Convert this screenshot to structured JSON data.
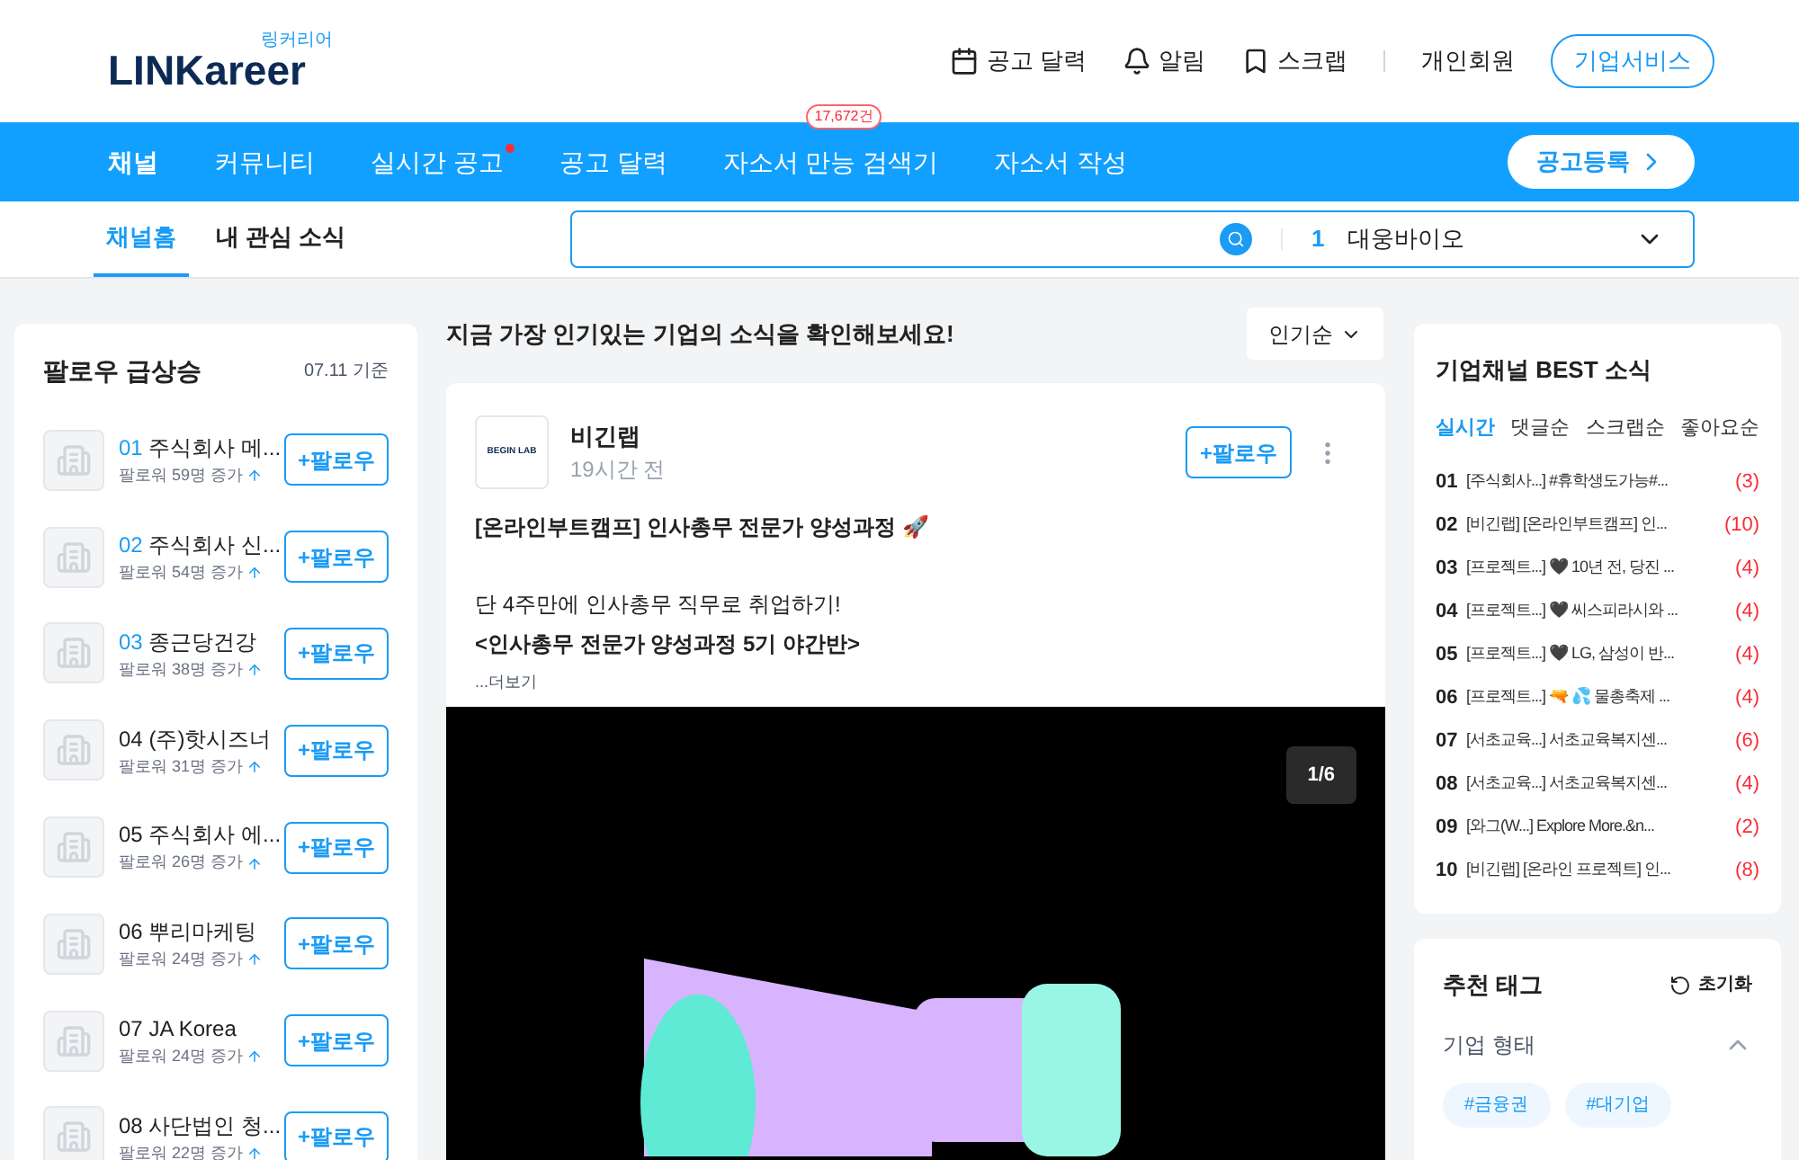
{
  "header": {
    "logo_caption": "링커리어",
    "logo": "LINKareer",
    "links": [
      {
        "kind": "calendar",
        "label": "공고 달력"
      },
      {
        "kind": "bell",
        "label": "알림"
      },
      {
        "kind": "bookmark",
        "label": "스크랩"
      }
    ],
    "member": "개인회원",
    "service_button": "기업서비스"
  },
  "nav": {
    "items": [
      {
        "label": "채널",
        "selected": true,
        "dot": false
      },
      {
        "label": "커뮤니티",
        "selected": false,
        "dot": false
      },
      {
        "label": "실시간 공고",
        "selected": false,
        "dot": true
      },
      {
        "label": "공고 달력",
        "selected": false,
        "dot": false
      },
      {
        "label": "자소서 만능 검색기",
        "selected": false,
        "dot": false,
        "badge": "17,672건"
      },
      {
        "label": "자소서 작성",
        "selected": false,
        "dot": false
      }
    ],
    "cta": "공고등록"
  },
  "subnav": {
    "tabs": [
      {
        "label": "채널홈",
        "selected": true
      },
      {
        "label": "내 관심 소식",
        "selected": false
      }
    ],
    "search": {
      "rank": "1",
      "keyword": "대웅바이오"
    }
  },
  "follow_rank": {
    "title": "팔로우 급상승",
    "date": "07.11 기준",
    "items": [
      {
        "rank": "01",
        "name": "주식회사 메...",
        "increase": "팔로워 59명 증가",
        "top": true,
        "button": "+팔로우"
      },
      {
        "rank": "02",
        "name": "주식회사 신...",
        "increase": "팔로워 54명 증가",
        "top": true,
        "button": "+팔로우"
      },
      {
        "rank": "03",
        "name": "종근당건강",
        "increase": "팔로워 38명 증가",
        "top": true,
        "button": "+팔로우"
      },
      {
        "rank": "04",
        "name": "(주)핫시즈너",
        "increase": "팔로워 31명 증가",
        "top": false,
        "button": "+팔로우"
      },
      {
        "rank": "05",
        "name": "주식회사 에...",
        "increase": "팔로워 26명 증가",
        "top": false,
        "button": "+팔로우"
      },
      {
        "rank": "06",
        "name": "뿌리마케팅",
        "increase": "팔로워 24명 증가",
        "top": false,
        "button": "+팔로우"
      },
      {
        "rank": "07",
        "name": "JA Korea",
        "increase": "팔로워 24명 증가",
        "top": false,
        "button": "+팔로우"
      },
      {
        "rank": "08",
        "name": "사단법인 청...",
        "increase": "팔로워 22명 증가",
        "top": false,
        "button": "+팔로우"
      }
    ]
  },
  "feed": {
    "heading": "지금 가장 인기있는 기업의 소식을 확인해보세요!",
    "sort": "인기순",
    "post": {
      "logo_text": "BEGIN LAB",
      "company": "비긴랩",
      "time": "19시간 전",
      "follow": "+팔로우",
      "title": "[온라인부트캠프] 인사총무 전문가 양성과정 🚀",
      "line1": "단 4주만에 인사총무 직무로 취업하기!",
      "line2": "<인사총무 전문가 양성과정 5기 야간반>",
      "more": "...더보기",
      "counter": "1/6"
    }
  },
  "best": {
    "title": "기업채널 BEST 소식",
    "tabs": [
      {
        "label": "실시간",
        "selected": true
      },
      {
        "label": "댓글순",
        "selected": false
      },
      {
        "label": "스크랩순",
        "selected": false
      },
      {
        "label": "좋아요순",
        "selected": false
      }
    ],
    "items": [
      {
        "rank": "01",
        "text": "[주식회사...] #휴학생도가능#...",
        "count": "(3)"
      },
      {
        "rank": "02",
        "text": "[비긴랩] [온라인부트캠프] 인...",
        "count": "(10)"
      },
      {
        "rank": "03",
        "text": "[프로젝트...] 🖤 10년 전, 당진 ...",
        "count": "(4)"
      },
      {
        "rank": "04",
        "text": "[프로젝트...] 🖤 씨스피라시와 ...",
        "count": "(4)"
      },
      {
        "rank": "05",
        "text": "[프로젝트...] 🖤 LG, 삼성이 반...",
        "count": "(4)"
      },
      {
        "rank": "06",
        "text": "[프로젝트...] 🔫 💦 물총축제 ...",
        "count": "(4)"
      },
      {
        "rank": "07",
        "text": "[서초교육...] 서초교육복지센...",
        "count": "(6)"
      },
      {
        "rank": "08",
        "text": "[서초교육...] 서초교육복지센...",
        "count": "(4)"
      },
      {
        "rank": "09",
        "text": "[와그(W...] Explore More.&n...",
        "count": "(2)"
      },
      {
        "rank": "10",
        "text": "[비긴랩] [온라인 프로젝트] 인...",
        "count": "(8)"
      }
    ]
  },
  "tags": {
    "title": "추천 태그",
    "reset": "초기화",
    "group": {
      "label": "기업 형태",
      "expanded": true,
      "tags": [
        "#금융권",
        "#대기업"
      ]
    }
  }
}
